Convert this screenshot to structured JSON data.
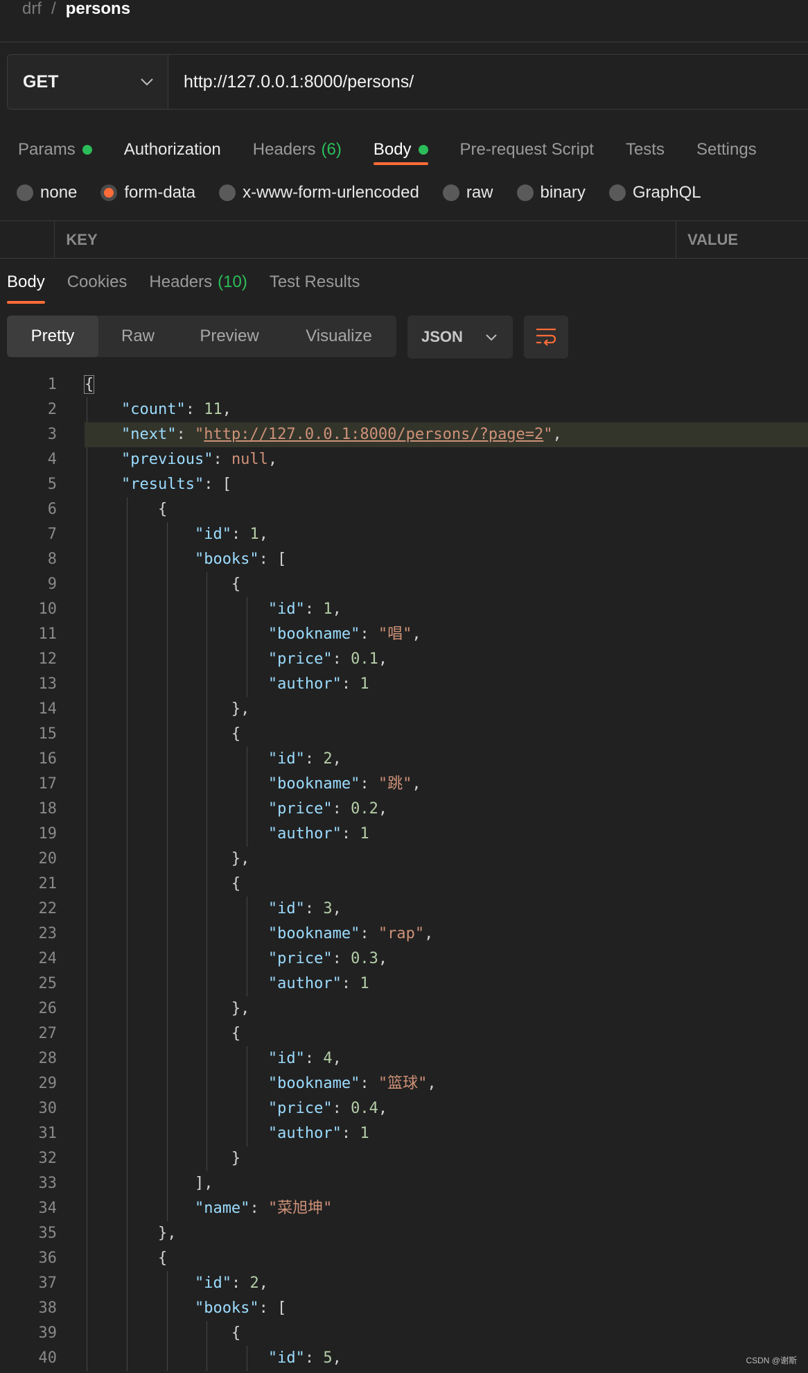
{
  "breadcrumb": {
    "parent": "drf",
    "separator": "/",
    "current": "persons"
  },
  "request": {
    "method": "GET",
    "url": "http://127.0.0.1:8000/persons/"
  },
  "request_tabs": [
    {
      "label": "Params",
      "dot": true
    },
    {
      "label": "Authorization"
    },
    {
      "label": "Headers",
      "count": "(6)"
    },
    {
      "label": "Body",
      "dot": true,
      "active": true
    },
    {
      "label": "Pre-request Script"
    },
    {
      "label": "Tests"
    },
    {
      "label": "Settings"
    }
  ],
  "body_types": [
    "none",
    "form-data",
    "x-www-form-urlencoded",
    "raw",
    "binary",
    "GraphQL"
  ],
  "body_type_selected": "form-data",
  "kv_table": {
    "key_header": "KEY",
    "value_header": "VALUE"
  },
  "response_tabs": [
    {
      "label": "Body",
      "active": true
    },
    {
      "label": "Cookies"
    },
    {
      "label": "Headers",
      "count": "(10)"
    },
    {
      "label": "Test Results"
    }
  ],
  "view_modes": [
    "Pretty",
    "Raw",
    "Preview",
    "Visualize"
  ],
  "view_mode_selected": "Pretty",
  "format": "JSON",
  "colors": {
    "accent": "#ff6c37",
    "dot": "#2bbd59",
    "key": "#9cdcfe",
    "number": "#b5cea8",
    "string": "#ce9178"
  },
  "code_lines": [
    "{",
    "    \"count\": 11,",
    "    \"next\": \"http://127.0.0.1:8000/persons/?page=2\",",
    "    \"previous\": null,",
    "    \"results\": [",
    "        {",
    "            \"id\": 1,",
    "            \"books\": [",
    "                {",
    "                    \"id\": 1,",
    "                    \"bookname\": \"唱\",",
    "                    \"price\": 0.1,",
    "                    \"author\": 1",
    "                },",
    "                {",
    "                    \"id\": 2,",
    "                    \"bookname\": \"跳\",",
    "                    \"price\": 0.2,",
    "                    \"author\": 1",
    "                },",
    "                {",
    "                    \"id\": 3,",
    "                    \"bookname\": \"rap\",",
    "                    \"price\": 0.3,",
    "                    \"author\": 1",
    "                },",
    "                {",
    "                    \"id\": 4,",
    "                    \"bookname\": \"篮球\",",
    "                    \"price\": 0.4,",
    "                    \"author\": 1",
    "                }",
    "            ],",
    "            \"name\": \"菜旭坤\"",
    "        },",
    "        {",
    "            \"id\": 2,",
    "            \"books\": [",
    "                {",
    "                    \"id\": 5,"
  ],
  "highlighted_line": 3,
  "watermark": "CSDN @谢斯"
}
